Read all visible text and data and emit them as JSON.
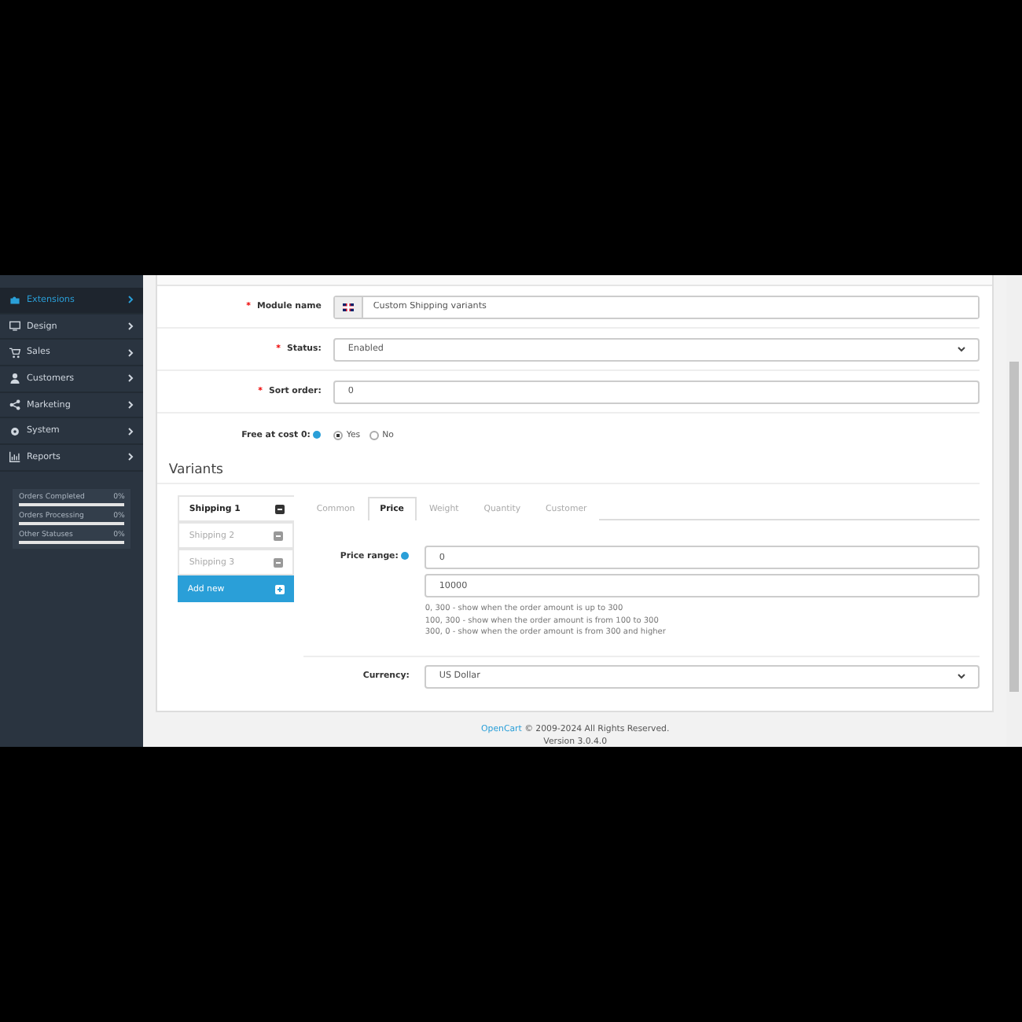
{
  "sidebar": {
    "items": [
      {
        "label": "Extensions",
        "selected": true
      },
      {
        "label": "Design",
        "selected": false
      },
      {
        "label": "Sales",
        "selected": false
      },
      {
        "label": "Customers",
        "selected": false
      },
      {
        "label": "Marketing",
        "selected": false
      },
      {
        "label": "System",
        "selected": false
      },
      {
        "label": "Reports",
        "selected": false
      }
    ],
    "stats": [
      {
        "label": "Orders Completed",
        "value": "0%",
        "level": 0
      },
      {
        "label": "Orders Processing",
        "value": "0%",
        "level": 0
      },
      {
        "label": "Other Statuses",
        "value": "0%",
        "level": 0
      }
    ]
  },
  "form": {
    "module_name": {
      "required_mark": "*",
      "label": "Module name",
      "value": "Custom Shipping variants"
    },
    "status": {
      "required_mark": "*",
      "label": "Status:",
      "value": "Enabled"
    },
    "sort_order": {
      "required_mark": "*",
      "label": "Sort order:",
      "value": "0"
    },
    "free_at_cost": {
      "label": "Free at cost 0:",
      "options": [
        {
          "label": "Yes",
          "selected": true
        },
        {
          "label": "No",
          "selected": false
        }
      ]
    }
  },
  "variants": {
    "title": "Variants",
    "items": [
      {
        "label": "Shipping 1",
        "selected": true
      },
      {
        "label": "Shipping 2",
        "selected": false
      },
      {
        "label": "Shipping 3",
        "selected": false
      }
    ],
    "add_label": "Add new",
    "tabs": [
      {
        "label": "Common",
        "selected": false
      },
      {
        "label": "Price",
        "selected": true
      },
      {
        "label": "Weight",
        "selected": false
      },
      {
        "label": "Quantity",
        "selected": false
      },
      {
        "label": "Customer",
        "selected": false
      }
    ],
    "price_range": {
      "label": "Price range:",
      "from": "0",
      "to": "10000",
      "help": [
        "0, 300 - show when the order amount is up to 300",
        "100, 300 - show when the order amount is from 100 to 300",
        "300, 0 - show when the order amount is from 300 and higher"
      ]
    },
    "currency": {
      "label": "Currency:",
      "value": "US Dollar"
    }
  },
  "footer": {
    "link": "OpenCart",
    "copyright": "© 2009-2024 All Rights Reserved.",
    "version": "Version 3.0.4.0"
  }
}
